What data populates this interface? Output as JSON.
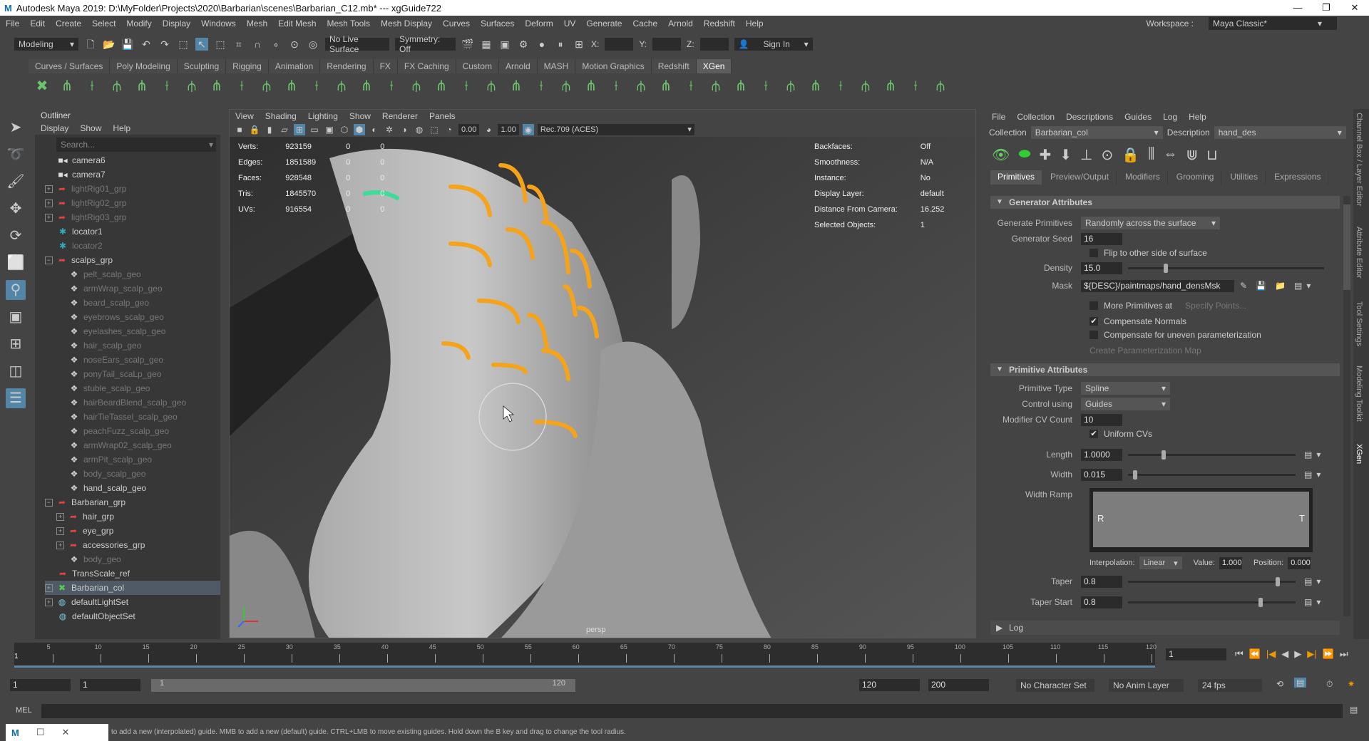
{
  "window": {
    "title": "Autodesk Maya 2019: D:\\MyFolder\\Projects\\2020\\Barbarian\\scenes\\Barbarian_C12.mb*  ---  xgGuide722",
    "controls": [
      "—",
      "❐",
      "✕"
    ]
  },
  "menubar": {
    "items": [
      "File",
      "Edit",
      "Create",
      "Select",
      "Modify",
      "Display",
      "Windows",
      "Mesh",
      "Edit Mesh",
      "Mesh Tools",
      "Mesh Display",
      "Curves",
      "Surfaces",
      "Deform",
      "UV",
      "Generate",
      "Cache",
      "Arnold",
      "Redshift",
      "Help"
    ],
    "workspace_label": "Workspace :",
    "workspace_value": "Maya Classic*"
  },
  "status": {
    "mode": "Modeling",
    "live_surface": "No Live Surface",
    "symmetry": "Symmetry: Off",
    "x_label": "X:",
    "y_label": "Y:",
    "z_label": "Z:",
    "sign_in": "Sign In"
  },
  "shelf": {
    "tabs": [
      "Curves / Surfaces",
      "Poly Modeling",
      "Sculpting",
      "Rigging",
      "Animation",
      "Rendering",
      "FX",
      "FX Caching",
      "Custom",
      "Arnold",
      "MASH",
      "Motion Graphics",
      "Redshift",
      "XGen"
    ],
    "active": "XGen"
  },
  "outliner": {
    "title": "Outliner",
    "menu": [
      "Display",
      "Show",
      "Help"
    ],
    "search_placeholder": "Search...",
    "items": [
      {
        "label": "camera6",
        "icon": "camera-icon",
        "indent": 1,
        "dim": false,
        "expand": ""
      },
      {
        "label": "camera7",
        "icon": "camera-icon",
        "indent": 1,
        "dim": false,
        "expand": ""
      },
      {
        "label": "lightRig01_grp",
        "icon": "group-icon",
        "indent": 0,
        "dim": true,
        "expand": "+"
      },
      {
        "label": "lightRig02_grp",
        "icon": "group-icon",
        "indent": 0,
        "dim": true,
        "expand": "+"
      },
      {
        "label": "lightRig03_grp",
        "icon": "group-icon",
        "indent": 0,
        "dim": true,
        "expand": "+"
      },
      {
        "label": "locator1",
        "icon": "locator-icon",
        "indent": 1,
        "dim": false,
        "expand": ""
      },
      {
        "label": "locator2",
        "icon": "locator-icon",
        "indent": 1,
        "dim": true,
        "expand": ""
      },
      {
        "label": "scalps_grp",
        "icon": "group-icon",
        "indent": 0,
        "dim": false,
        "expand": "−"
      },
      {
        "label": "pelt_scalp_geo",
        "icon": "mesh-icon",
        "indent": 2,
        "dim": true,
        "expand": ""
      },
      {
        "label": "armWrap_scalp_geo",
        "icon": "mesh-icon",
        "indent": 2,
        "dim": true,
        "expand": ""
      },
      {
        "label": "beard_scalp_geo",
        "icon": "mesh-icon",
        "indent": 2,
        "dim": true,
        "expand": ""
      },
      {
        "label": "eyebrows_scalp_geo",
        "icon": "mesh-icon",
        "indent": 2,
        "dim": true,
        "expand": ""
      },
      {
        "label": "eyelashes_scalp_geo",
        "icon": "mesh-icon",
        "indent": 2,
        "dim": true,
        "expand": ""
      },
      {
        "label": "hair_scalp_geo",
        "icon": "mesh-icon",
        "indent": 2,
        "dim": true,
        "expand": ""
      },
      {
        "label": "noseEars_scalp_geo",
        "icon": "mesh-icon",
        "indent": 2,
        "dim": true,
        "expand": ""
      },
      {
        "label": "ponyTail_scaLp_geo",
        "icon": "mesh-icon",
        "indent": 2,
        "dim": true,
        "expand": ""
      },
      {
        "label": "stuble_scalp_geo",
        "icon": "mesh-icon",
        "indent": 2,
        "dim": true,
        "expand": ""
      },
      {
        "label": "hairBeardBlend_scalp_geo",
        "icon": "mesh-icon",
        "indent": 2,
        "dim": true,
        "expand": ""
      },
      {
        "label": "hairTieTassel_scalp_geo",
        "icon": "mesh-icon",
        "indent": 2,
        "dim": true,
        "expand": ""
      },
      {
        "label": "peachFuzz_scalp_geo",
        "icon": "mesh-icon",
        "indent": 2,
        "dim": true,
        "expand": ""
      },
      {
        "label": "armWrap02_scalp_geo",
        "icon": "mesh-icon",
        "indent": 2,
        "dim": true,
        "expand": ""
      },
      {
        "label": "armPit_scalp_geo",
        "icon": "mesh-icon",
        "indent": 2,
        "dim": true,
        "expand": ""
      },
      {
        "label": "body_scalp_geo",
        "icon": "mesh-icon",
        "indent": 2,
        "dim": true,
        "expand": ""
      },
      {
        "label": "hand_scalp_geo",
        "icon": "mesh-icon",
        "indent": 2,
        "dim": false,
        "expand": ""
      },
      {
        "label": "Barbarian_grp",
        "icon": "group-icon",
        "indent": 0,
        "dim": false,
        "expand": "−"
      },
      {
        "label": "hair_grp",
        "icon": "group-icon",
        "indent": 1,
        "dim": false,
        "expand": "+"
      },
      {
        "label": "eye_grp",
        "icon": "group-icon",
        "indent": 1,
        "dim": false,
        "expand": "+"
      },
      {
        "label": "accessories_grp",
        "icon": "group-icon",
        "indent": 1,
        "dim": false,
        "expand": "+"
      },
      {
        "label": "body_geo",
        "icon": "mesh-icon",
        "indent": 2,
        "dim": true,
        "expand": ""
      },
      {
        "label": "TransScale_ref",
        "icon": "group-icon",
        "indent": 1,
        "dim": false,
        "expand": ""
      },
      {
        "label": "Barbarian_col",
        "icon": "xgen-collection-icon",
        "indent": 0,
        "dim": false,
        "expand": "+",
        "selected": true
      },
      {
        "label": "defaultLightSet",
        "icon": "set-icon",
        "indent": 0,
        "dim": false,
        "expand": "+"
      },
      {
        "label": "defaultObjectSet",
        "icon": "set-icon",
        "indent": 1,
        "dim": false,
        "expand": ""
      }
    ]
  },
  "viewport": {
    "menu": [
      "View",
      "Shading",
      "Lighting",
      "Show",
      "Renderer",
      "Panels"
    ],
    "exposure": "0.00",
    "gamma": "1.00",
    "color_space": "Rec.709 (ACES)",
    "camera": "persp",
    "hud_left": [
      [
        "Verts:",
        "923159",
        "0",
        "0"
      ],
      [
        "Edges:",
        "1851589",
        "0",
        "0"
      ],
      [
        "Faces:",
        "928548",
        "0",
        "0"
      ],
      [
        "Tris:",
        "1845570",
        "0",
        "0"
      ],
      [
        "UVs:",
        "916554",
        "0",
        "0"
      ]
    ],
    "hud_right": [
      [
        "Backfaces:",
        "Off"
      ],
      [
        "Smoothness:",
        "N/A"
      ],
      [
        "Instance:",
        "No"
      ],
      [
        "Display Layer:",
        "default"
      ],
      [
        "Distance From Camera:",
        "16.252"
      ],
      [
        "Selected Objects:",
        "1"
      ]
    ],
    "guide_color": "#f5a31a",
    "selected_guide_color": "#3ddc97"
  },
  "xgen": {
    "menu": [
      "File",
      "Collection",
      "Descriptions",
      "Guides",
      "Log",
      "Help"
    ],
    "collection_label": "Collection",
    "collection": "Barbarian_col",
    "description_label": "Description",
    "description": "hand_des",
    "tabs": [
      "Primitives",
      "Preview/Output",
      "Modifiers",
      "Grooming",
      "Utilities",
      "Expressions"
    ],
    "generator": {
      "title": "Generator Attributes",
      "generate_label": "Generate Primitives",
      "generate": "Randomly across the surface",
      "seed_label": "Generator Seed",
      "seed": "16",
      "flip_label": "Flip to other side of surface",
      "flip": false,
      "density_label": "Density",
      "density": "15.0",
      "density_slider": 0.18,
      "mask_label": "Mask",
      "mask": "${DESC}/paintmaps/hand_densMsk",
      "more_label": "More Primitives at",
      "more": false,
      "specify": "Specify Points...",
      "comp_normals_label": "Compensate Normals",
      "comp_normals": true,
      "comp_uneven_label": "Compensate for uneven parameterization",
      "comp_uneven": false,
      "create_map": "Create Parameterization Map"
    },
    "primitive": {
      "title": "Primitive Attributes",
      "type_label": "Primitive Type",
      "type": "Spline",
      "control_label": "Control using",
      "control": "Guides",
      "cv_label": "Modifier CV Count",
      "cv": "10",
      "uniform_label": "Uniform CVs",
      "uniform": true,
      "length_label": "Length",
      "length": "1.0000",
      "length_slider": 0.2,
      "width_label": "Width",
      "width": "0.015",
      "width_slider": 0.03,
      "ramp_label": "Width Ramp",
      "ramp_left": "R",
      "ramp_right": "T",
      "interp_label": "Interpolation:",
      "interp": "Linear",
      "value_label": "Value:",
      "value": "1.000",
      "position_label": "Position:",
      "position": "0.000",
      "taper_label": "Taper",
      "taper": "0.8",
      "taper_slider": 0.88,
      "taper_start_label": "Taper Start",
      "taper_start": "0.8",
      "taper_start_slider": 0.78
    },
    "log": "Log"
  },
  "sidetabs": [
    "Channel Box / Layer Editor",
    "Attribute Editor",
    "Tool Settings",
    "Modeling Toolkit",
    "XGen"
  ],
  "timeline": {
    "ticks": [
      "5",
      "10",
      "15",
      "20",
      "25",
      "30",
      "35",
      "40",
      "45",
      "50",
      "55",
      "60",
      "65",
      "70",
      "75",
      "80",
      "85",
      "90",
      "95",
      "100",
      "105",
      "110",
      "115",
      "120"
    ],
    "current": "1",
    "current_field": "1"
  },
  "range": {
    "start": "1",
    "inner_start": "1",
    "slider_start": "1",
    "slider_end": "120",
    "end": "120",
    "max": "200",
    "character_set": "No Character Set",
    "anim_layer": "No Anim Layer",
    "fps": "24 fps"
  },
  "mel": {
    "label": "MEL"
  },
  "help": "to add a new (interpolated) guide. MMB to add a new (default) guide. CTRL+LMB to move existing guides. Hold down the B key and drag to change the tool radius."
}
